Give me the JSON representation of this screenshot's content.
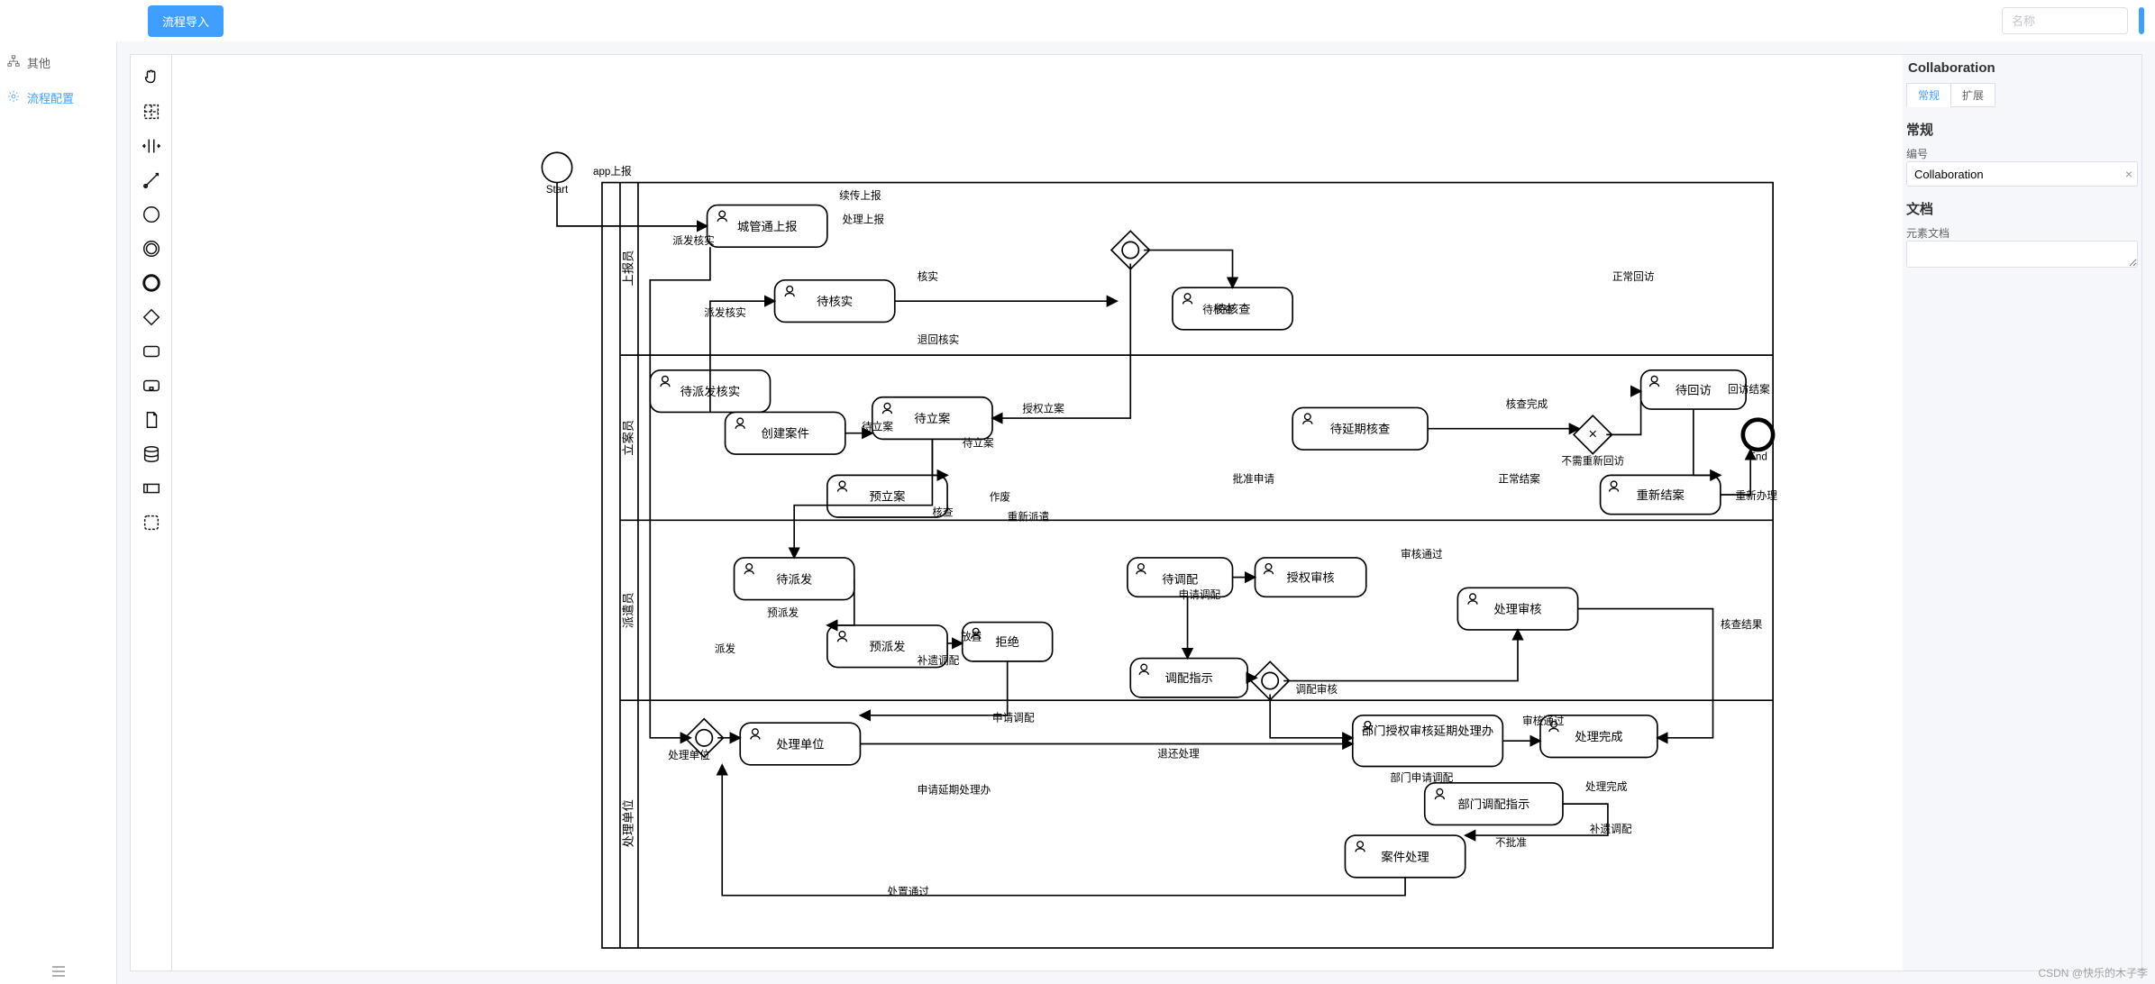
{
  "topbar": {
    "import_btn": "流程导入",
    "name_placeholder": "名称"
  },
  "sidebar": {
    "items": [
      {
        "label": "其他",
        "active": false,
        "icon": "sitemap"
      },
      {
        "label": "流程配置",
        "active": true,
        "icon": "gear"
      }
    ]
  },
  "palette": {
    "tools": [
      "hand",
      "lasso",
      "space",
      "connect",
      "start-event",
      "intermediate-event",
      "end-event",
      "gateway",
      "task",
      "sub-process",
      "data-object",
      "data-store",
      "participant",
      "group"
    ]
  },
  "props": {
    "title": "Collaboration",
    "tabs": {
      "general": "常规",
      "extension": "扩展"
    },
    "section_general": "常规",
    "id_label": "编号",
    "id_value": "Collaboration",
    "section_doc": "文档",
    "doc_label": "元素文档",
    "doc_value": ""
  },
  "diagram": {
    "start_label": "Start",
    "end_label": "End",
    "start_edge": "app上报",
    "lanes": [
      "上报员",
      "立案员",
      "派遣员",
      "处理单位"
    ],
    "tasks": {
      "t1": "城管通上报",
      "t2": "待派发核实",
      "t3": "待核实",
      "t4": "待核查",
      "t5": "创建案件",
      "t6": "待立案",
      "t7": "预立案",
      "t8": "待派发",
      "t9": "预派发",
      "t10": "拒绝",
      "t11": "调配指示",
      "t12": "待调配",
      "t13": "授权审核",
      "t14": "待延期核查",
      "t15": "待回访",
      "t16": "重新结案",
      "t17": "处理审核",
      "t18": "处理单位",
      "t19": "部门授权审核延期处理办",
      "t20": "处理完成",
      "t21": "部门调配指示",
      "t22": "案件处理"
    },
    "edge_labels": {
      "e1": "派发核实",
      "e2": "续传上报",
      "e3": "处理上报",
      "e4": "核实",
      "e5": "派发核实",
      "e6": "退回核实",
      "e7": "待核查",
      "e8": "核查完成",
      "e9": "待立案",
      "e10": "授权立案",
      "e11": "待立案",
      "e12": "作废",
      "e13": "核查",
      "e14": "重新派遣",
      "e15": "批准申请",
      "e16": "正常结案",
      "e17": "不需重新回访",
      "e18": "正常回访",
      "e19": "重新办理",
      "e20": "处理单位",
      "e21": "预派发",
      "e22": "补遗调配",
      "e23": "派发",
      "e24": "审核通过",
      "e25": "申请调配",
      "e26": "核查结果",
      "e27": "调配审核",
      "e28": "回访结案",
      "e29": "申请调配",
      "e30": "退还处理",
      "e31": "申请延期处理办",
      "e32": "部门申请调配",
      "e33": "不批准",
      "e34": "处理完成",
      "e35": "补遗调配",
      "e36": "处置通过",
      "e37": "放置",
      "e38": "审核通过"
    }
  },
  "watermark": "CSDN @快乐的木子李"
}
